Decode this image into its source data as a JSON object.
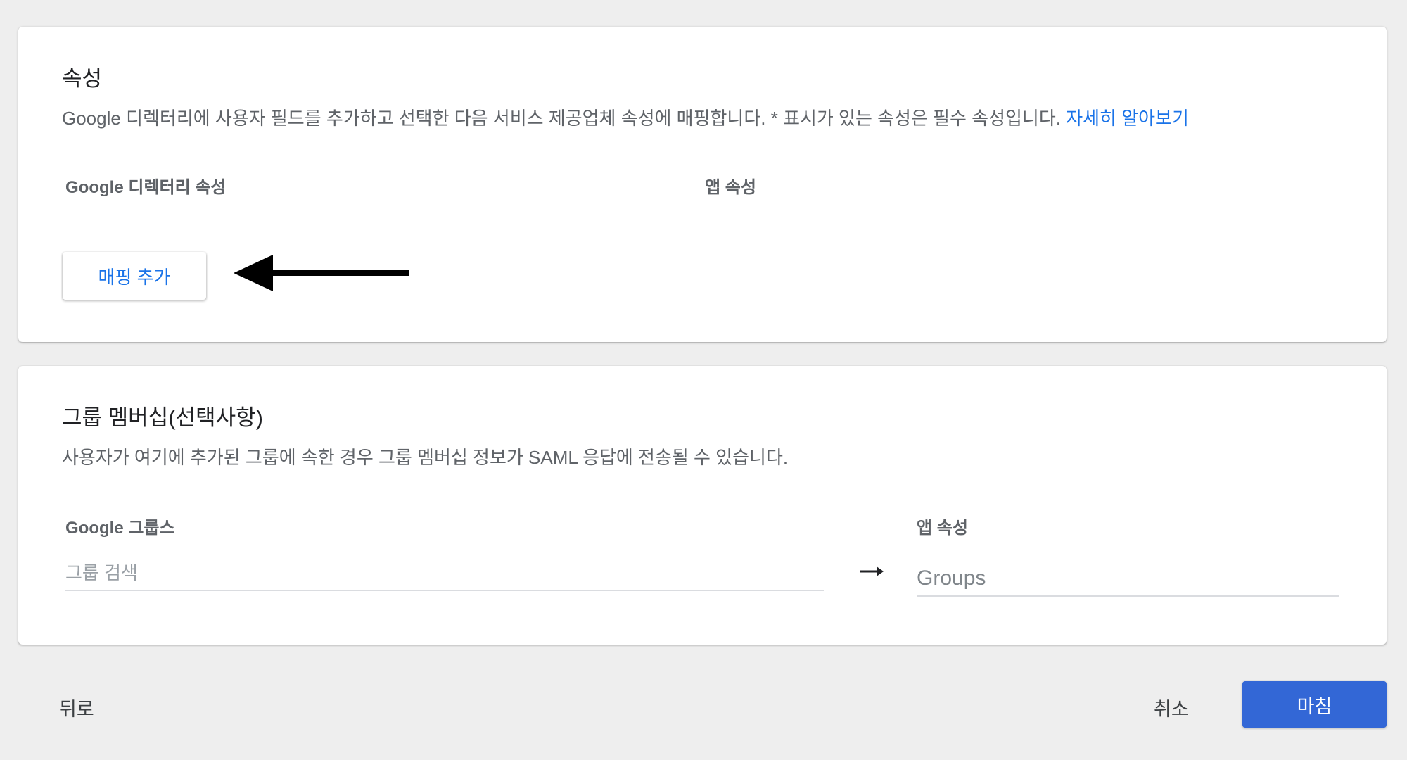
{
  "attributes_section": {
    "title": "속성",
    "description": "Google 디렉터리에 사용자 필드를 추가하고 선택한 다음 서비스 제공업체 속성에 매핑합니다. * 표시가 있는 속성은 필수 속성입니다. ",
    "learn_more": "자세히 알아보기",
    "col_google_directory": "Google 디렉터리 속성",
    "col_app_attribute": "앱 속성",
    "add_mapping_label": "매핑 추가"
  },
  "groups_section": {
    "title": "그룹 멤버십(선택사항)",
    "description": "사용자가 여기에 추가된 그룹에 속한 경우 그룹 멤버십 정보가 SAML 응답에 전송될 수 있습니다.",
    "col_google_groups": "Google 그룹스",
    "col_app_attribute": "앱 속성",
    "search_placeholder": "그룹 검색",
    "app_attribute_value": "Groups",
    "arrow_icon": "right-arrow-icon"
  },
  "footer": {
    "back_label": "뒤로",
    "cancel_label": "취소",
    "finish_label": "마침"
  },
  "annotation": {
    "arrow_icon": "left-arrow-icon"
  },
  "colors": {
    "accent": "#1a73e8",
    "primary_button": "#3367d6",
    "background": "#eeeeee"
  }
}
